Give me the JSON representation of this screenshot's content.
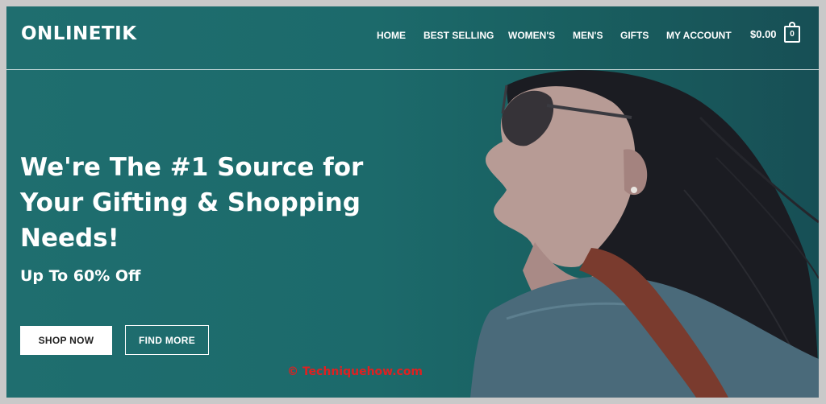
{
  "brand": {
    "name": "ONLINETIK"
  },
  "nav": {
    "items": [
      {
        "label": "HOME"
      },
      {
        "label": "BEST SELLING"
      },
      {
        "label": "WOMEN'S"
      },
      {
        "label": "MEN'S"
      },
      {
        "label": "GIFTS"
      },
      {
        "label": "MY ACCOUNT"
      }
    ]
  },
  "cart": {
    "total": "$0.00",
    "count": "0",
    "icon": "shopping-bag-icon"
  },
  "hero": {
    "headline": "We're The #1 Source for Your Gifting & Shopping Needs!",
    "subheadline": "Up To 60% Off",
    "primary_button": "SHOP NOW",
    "secondary_button": "FIND MORE",
    "image": "woman-in-sunglasses-photo"
  },
  "watermark": {
    "text": "© Techniquehow.com"
  },
  "colors": {
    "hero_background": "#1f6e6f",
    "text": "#ffffff",
    "watermark": "#e02020"
  }
}
